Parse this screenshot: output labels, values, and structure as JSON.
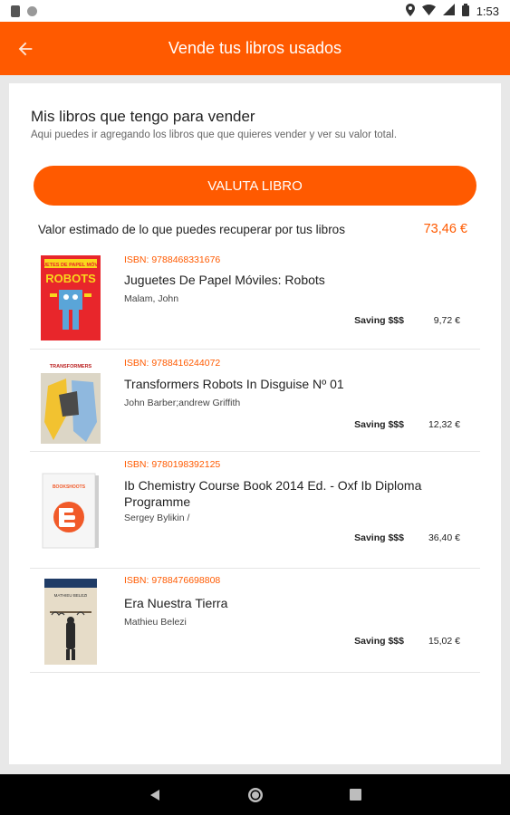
{
  "status_bar": {
    "time": "1:53"
  },
  "app_bar": {
    "title": "Vende tus libros usados"
  },
  "section": {
    "title": "Mis libros que tengo para vender",
    "subtitle": "Aqui puedes ir agregando los libros que que quieres vender y ver su valor total."
  },
  "valuta_button": {
    "label": "VALUTA LIBRO"
  },
  "estimate": {
    "label": "Valor estimado de lo que puedes recuperar por tus libros",
    "value": "73,46 €"
  },
  "books": [
    {
      "isbn": "ISBN: 9788468331676",
      "title": "Juguetes De Papel Móviles: Robots",
      "author": "Malam, John",
      "saving_label": "Saving $$$",
      "price": "9,72 €",
      "cover_text_top": "JUGUETES DE PAPEL MÓVILES",
      "cover_text_main": "ROBOTS",
      "cover_color": "#e8262b"
    },
    {
      "isbn": "ISBN: 9788416244072",
      "title": "Transformers Robots In Disguise Nº 01",
      "author": "John Barber;andrew Griffith",
      "saving_label": "Saving $$$",
      "price": "12,32 €",
      "cover_text_top": "TRANSFORMERS",
      "cover_color": "#f2c230"
    },
    {
      "isbn": "ISBN: 9780198392125",
      "title": " Ib Chemistry Course Book 2014 Ed. - Oxf Ib Diploma Programme",
      "author": "Sergey Bylikin /",
      "saving_label": "Saving $$$",
      "price": "36,40 €",
      "cover_text_top": "BOOKSHOOTS",
      "cover_color": "#f15a29"
    },
    {
      "isbn": "ISBN: 9788476698808",
      "title": "Era Nuestra Tierra",
      "author": "Mathieu Belezi",
      "saving_label": "Saving $$$",
      "price": "15,02 €",
      "cover_text_top": "MATHIEU BELEZI",
      "cover_color": "#e6dcc8"
    }
  ]
}
